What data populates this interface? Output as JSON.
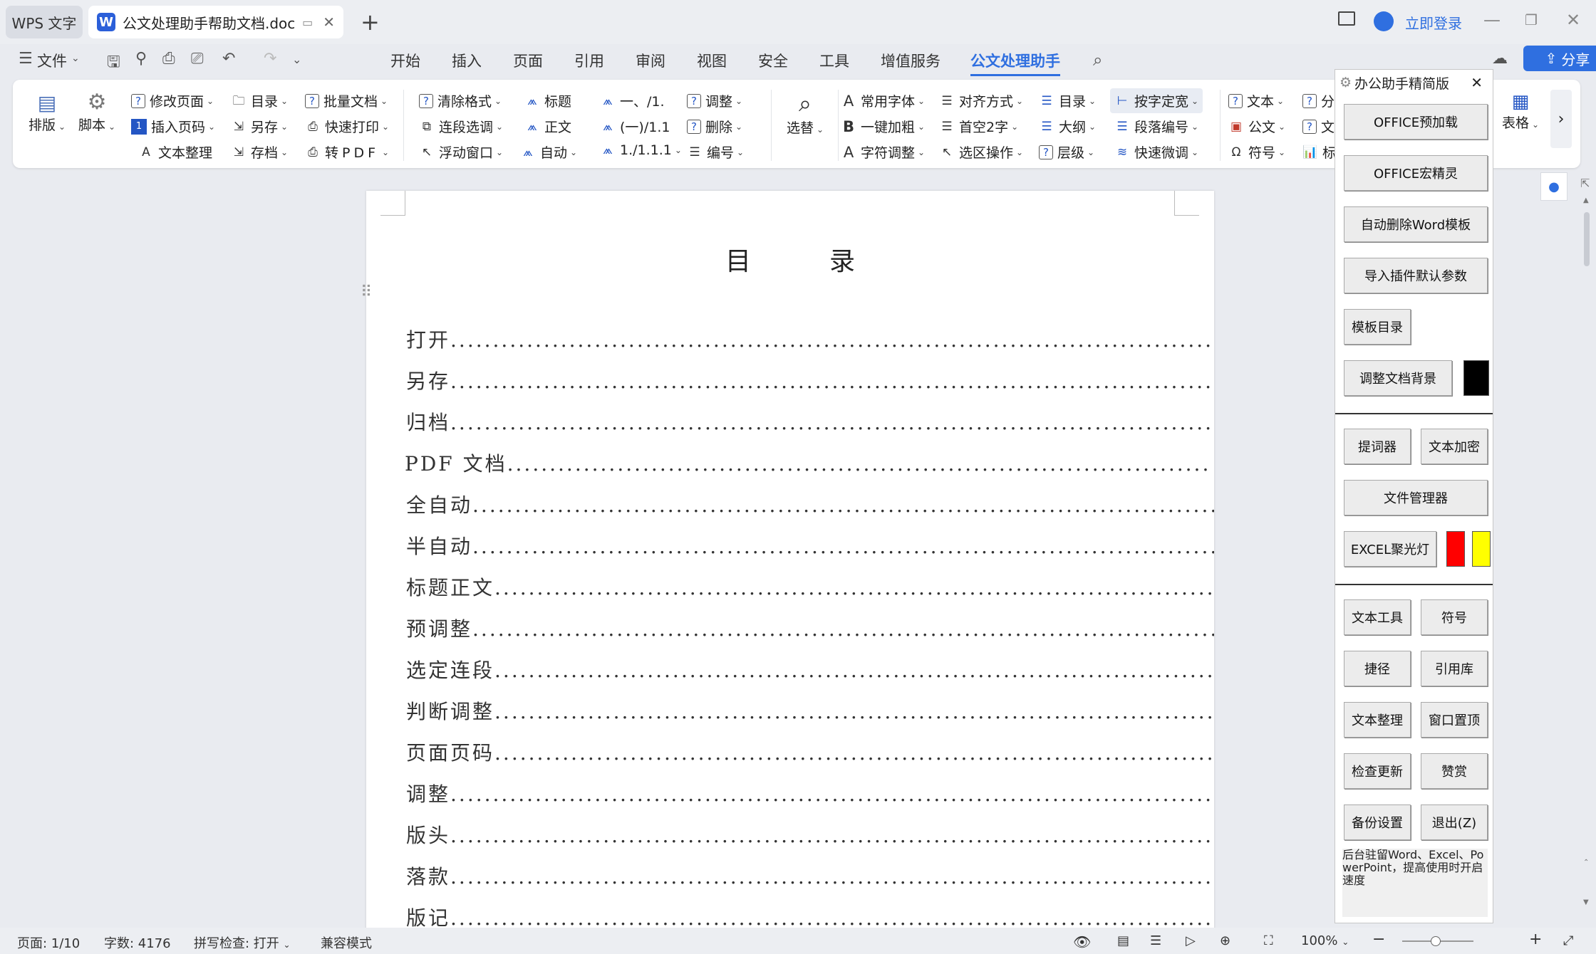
{
  "tabs": {
    "app": "WPS 文字",
    "doc": "公文处理助手帮助文档.doc",
    "doc_logo": "W"
  },
  "titlebar": {
    "login": "立即登录"
  },
  "menu": {
    "file": "文件",
    "items": [
      "开始",
      "插入",
      "页面",
      "引用",
      "审阅",
      "视图",
      "安全",
      "工具",
      "增值服务",
      "公文处理助手"
    ],
    "active": "公文处理助手",
    "share": "分享"
  },
  "ribbon": {
    "paiban": "排版",
    "jiaoben": "脚本",
    "g1": [
      "修改页面",
      "插入页码",
      "文本整理"
    ],
    "g2": [
      "目录",
      "另存",
      "存档"
    ],
    "g3": [
      "批量文档",
      "快速打印",
      "转PDF"
    ],
    "g4": [
      "清除格式",
      "连段选调",
      "浮动窗口"
    ],
    "g5": [
      "标题",
      "正文",
      "自动"
    ],
    "g6": [
      "一、/1.",
      "(一)/1.1",
      "1./1.1.1"
    ],
    "g7": [
      "调整",
      "删除",
      "编号"
    ],
    "xuanti": "选替",
    "g8": [
      "常用字体",
      "一键加粗",
      "字符调整"
    ],
    "g9": [
      "对齐方式",
      "首空2字",
      "选区操作"
    ],
    "g10": [
      "目录",
      "大纲",
      "层级"
    ],
    "g11": [
      "按字定宽",
      "段落编号",
      "快速微调"
    ],
    "g12": [
      "文本",
      "公文",
      "符号"
    ],
    "g13": [
      "分",
      "文",
      "标"
    ],
    "biaoge": "表格"
  },
  "document": {
    "title": "目录",
    "toc": [
      "打开",
      "另存",
      "归档",
      "PDF 文档",
      "全自动",
      "半自动",
      "标题正文",
      "预调整",
      "选定连段",
      "判断调整",
      "页面页码",
      "调整",
      "版头",
      "落款",
      "版记"
    ]
  },
  "panel": {
    "title": "办公助手精简版",
    "buttons1": [
      "OFFICE预加载",
      "OFFICE宏精灵",
      "自动删除Word模板",
      "导入插件默认参数",
      "模板目录",
      "调整文档背景"
    ],
    "buttons2": [
      "提词器",
      "文本加密",
      "文件管理器",
      "EXCEL聚光灯"
    ],
    "buttons3": [
      "文本工具",
      "符号",
      "捷径",
      "引用库",
      "文本整理",
      "窗口置顶",
      "检查更新",
      "赞赏",
      "备份设置",
      "退出(Z)"
    ],
    "note": "后台驻留Word、Excel、PowerPoint，提高使用时开启速度",
    "colors": {
      "background_swatch": "#000000",
      "spot_red": "#ff0000",
      "spot_yellow": "#ffff00"
    }
  },
  "status": {
    "page": "页面: 1/10",
    "words": "字数: 4176",
    "spell": "拼写检查: 打开",
    "mode": "兼容模式",
    "zoom": "100%",
    "zoom_level_percent": 40
  }
}
